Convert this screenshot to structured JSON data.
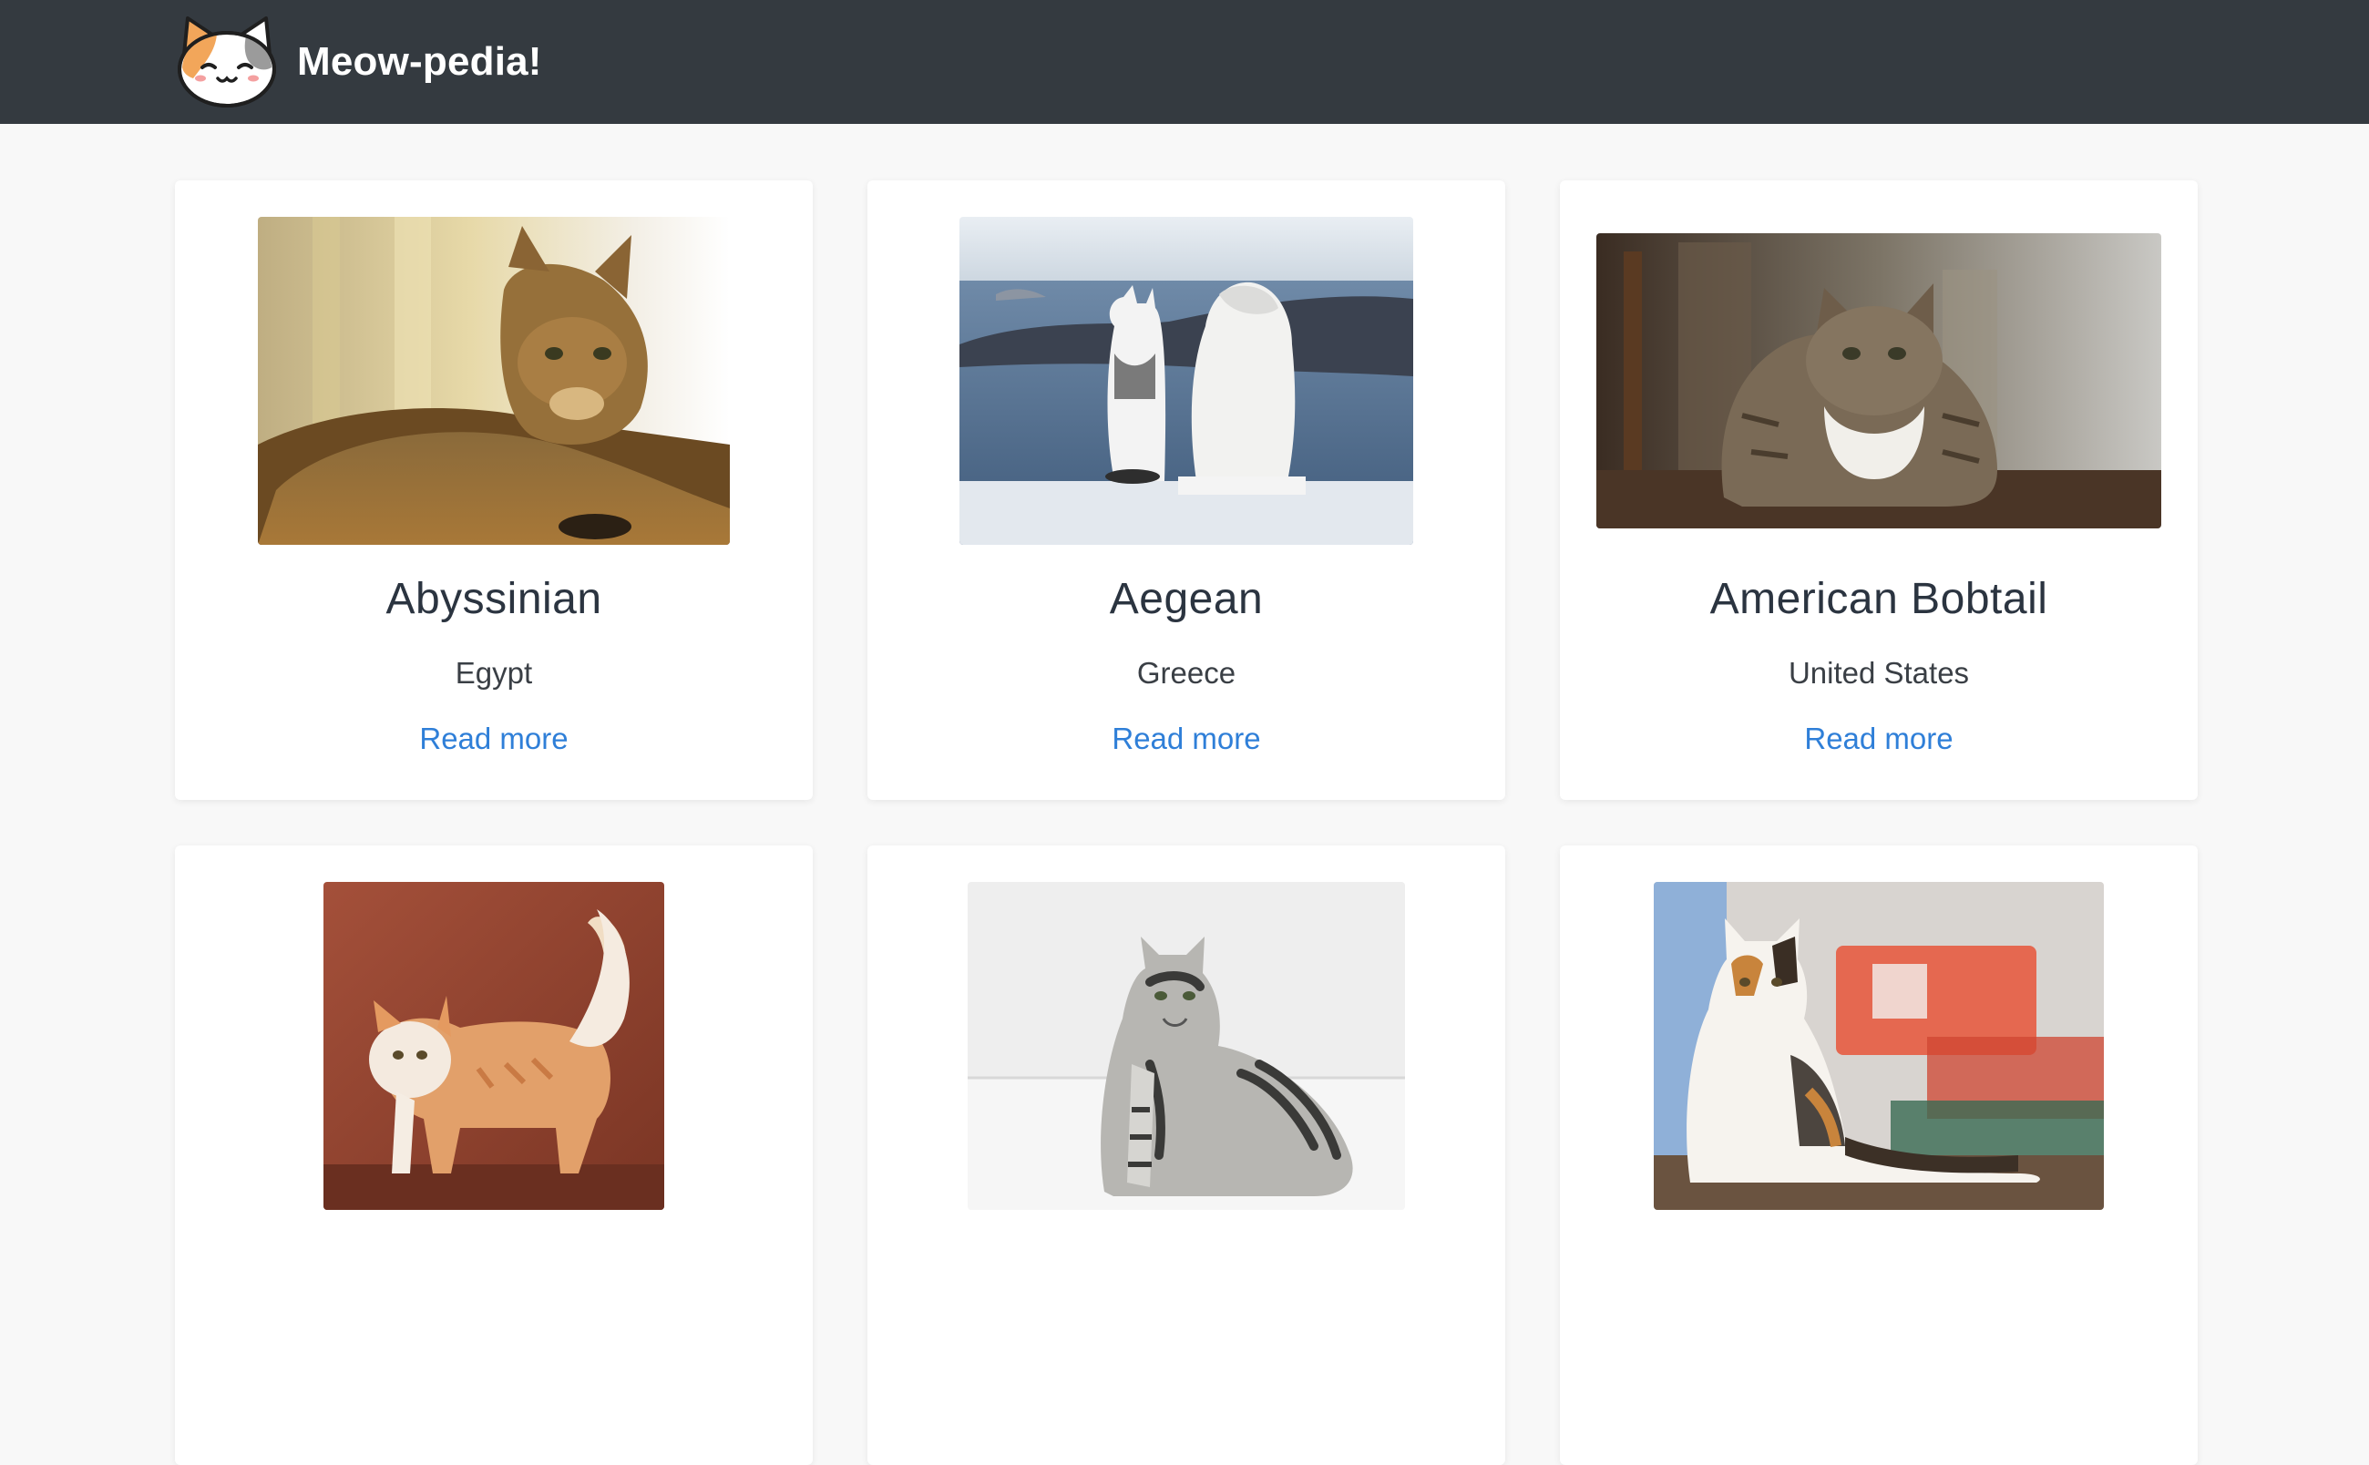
{
  "navbar": {
    "brand_name": "Meow-pedia!",
    "logo_icon": "calico-cat-face-icon",
    "background_color": "#343a40"
  },
  "accent_color": "#2f7fd8",
  "cards": [
    {
      "name": "Abyssinian",
      "origin": "Egypt",
      "link_label": "Read more",
      "image": "abyssinian-cat-photo"
    },
    {
      "name": "Aegean",
      "origin": "Greece",
      "link_label": "Read more",
      "image": "aegean-cat-photo"
    },
    {
      "name": "American Bobtail",
      "origin": "United States",
      "link_label": "Read more",
      "image": "american-bobtail-cat-photo"
    },
    {
      "name": "",
      "origin": "",
      "link_label": "",
      "image": "american-curl-cat-photo"
    },
    {
      "name": "",
      "origin": "",
      "link_label": "",
      "image": "american-shorthair-cat-photo"
    },
    {
      "name": "",
      "origin": "",
      "link_label": "",
      "image": "american-wirehair-cat-photo"
    }
  ]
}
